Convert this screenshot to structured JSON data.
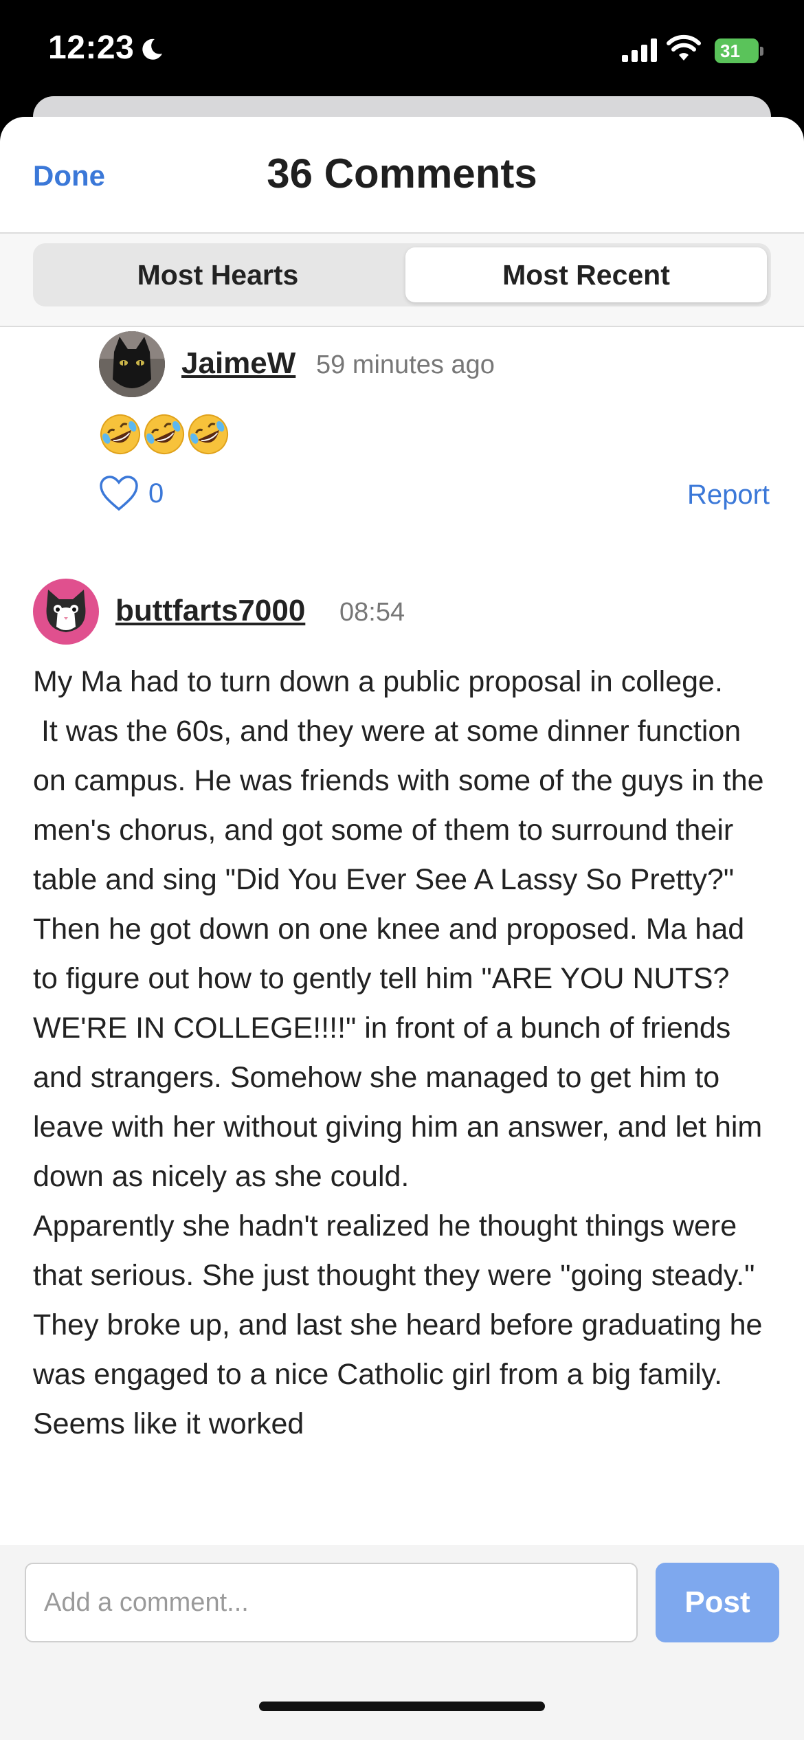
{
  "status_bar": {
    "time": "12:23",
    "battery": "31"
  },
  "header": {
    "done_label": "Done",
    "title": "36 Comments"
  },
  "tabs": [
    {
      "label": "Most Hearts",
      "selected": false
    },
    {
      "label": "Most Recent",
      "selected": true
    }
  ],
  "reply": {
    "username": "JaimeW",
    "time": "59 minutes ago",
    "emoji": "rolling-on-floor-laughing x3",
    "likes": "0",
    "report_label": "Report"
  },
  "comment": {
    "username": "buttfarts7000",
    "time": "08:54",
    "body": "My Ma had to turn down a public proposal in college.\n It was the 60s, and they were at some dinner function on campus. He was friends with some of the guys in the men's chorus, and got some of them to surround their table and sing \"Did You Ever See A Lassy So Pretty?\" Then he got down on one knee and proposed. Ma had to figure out how to gently tell him \"ARE YOU NUTS? WE'RE IN COLLEGE!!!!\" in front of a bunch of friends and strangers. Somehow she managed to get him to leave with her without giving him an answer, and let him down as nicely as she could.\nApparently she hadn't realized he thought things were that serious. She just thought they were \"going steady.\" They broke up, and last she heard before graduating he was engaged to a nice Catholic girl from a big family. Seems like it worked"
  },
  "composer": {
    "placeholder": "Add a comment...",
    "post_label": "Post"
  },
  "colors": {
    "accent": "#3b78d8",
    "post_button": "#7ea8ee",
    "avatar_pink": "#e0508e"
  }
}
